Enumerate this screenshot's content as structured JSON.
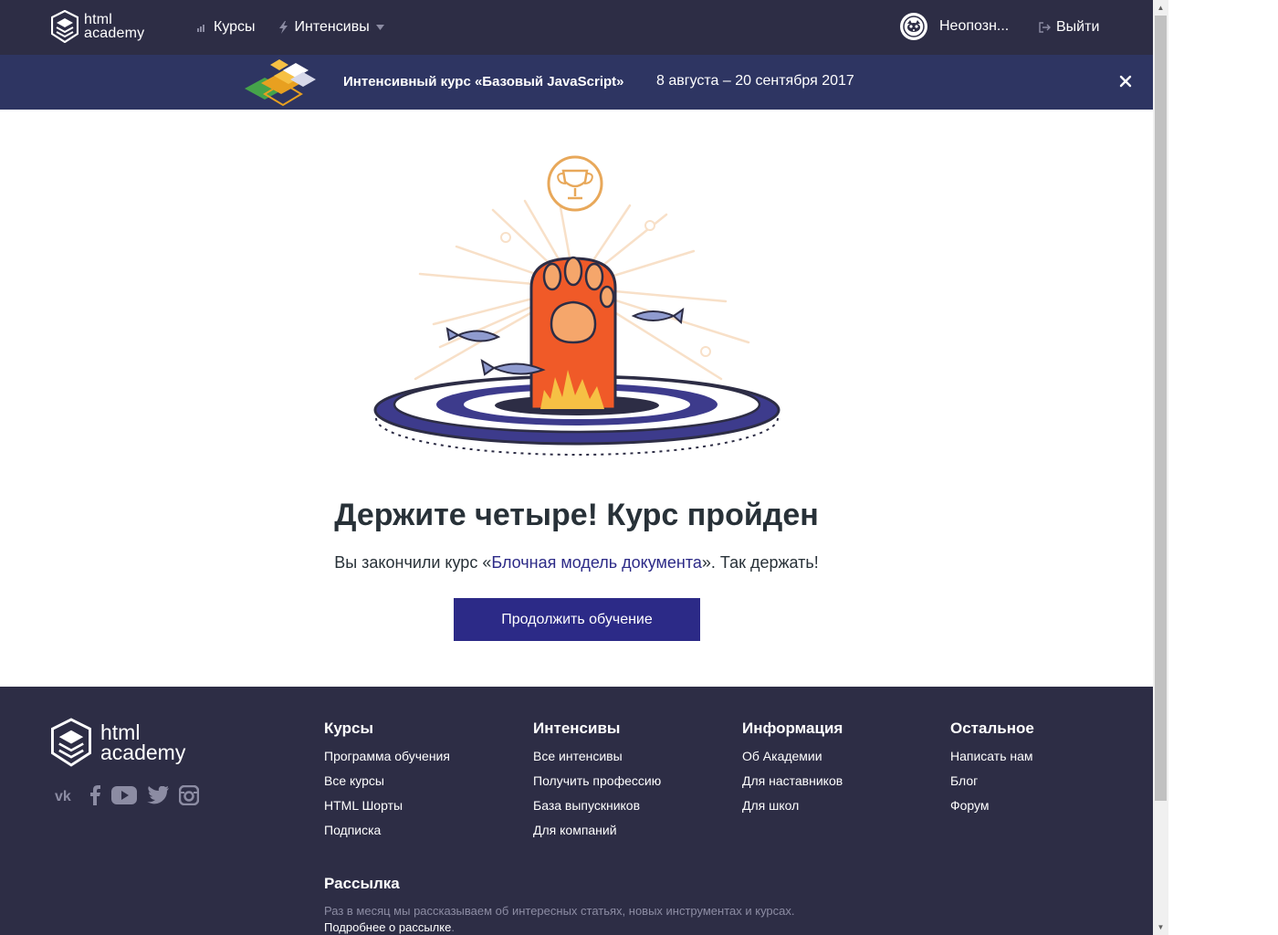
{
  "header": {
    "logo_line1": "html",
    "logo_line2": "academy",
    "nav": [
      {
        "label": "Курсы",
        "icon": "bar-chart-icon"
      },
      {
        "label": "Интенсивы",
        "icon": "lightning-icon"
      }
    ],
    "user_name": "Неопозн...",
    "logout_label": "Выйти"
  },
  "banner": {
    "title": "Интенсивный курс «Базовый JavaScript»",
    "dates": "8 августа – 20 сентября 2017",
    "close_icon": "close-icon"
  },
  "main": {
    "title": "Держите четыре! Курс пройден",
    "subtitle_before": "Вы закончили курс «",
    "subtitle_link": "Блочная модель документа",
    "subtitle_after": "». Так держать!",
    "cta_label": "Продолжить обучение"
  },
  "footer": {
    "logo_line1": "html",
    "logo_line2": "academy",
    "socials": [
      "vk-icon",
      "facebook-icon",
      "youtube-icon",
      "twitter-icon",
      "instagram-icon"
    ],
    "columns": [
      {
        "title": "Курсы",
        "links": [
          "Программа обучения",
          "Все курсы",
          "HTML Шорты",
          "Подписка"
        ]
      },
      {
        "title": "Интенсивы",
        "links": [
          "Все интенсивы",
          "Получить профессию",
          "База выпускников",
          "Для компаний"
        ]
      },
      {
        "title": "Информация",
        "links": [
          "Об Академии",
          "Для наставников",
          "Для школ"
        ]
      },
      {
        "title": "Остальное",
        "links": [
          "Написать нам",
          "Блог",
          "Форум"
        ]
      }
    ],
    "newsletter": {
      "title": "Рассылка",
      "text": "Раз в месяц мы рассказываем об интересных статьях, новых инструментах и курсах. ",
      "link": "Подробнее о рассылке",
      "tail": "."
    }
  },
  "colors": {
    "header_bg": "#2d2d45",
    "banner_bg": "#2e3562",
    "accent": "#2c2a87",
    "paw": "#f05a28",
    "gold": "#e8a85a"
  }
}
